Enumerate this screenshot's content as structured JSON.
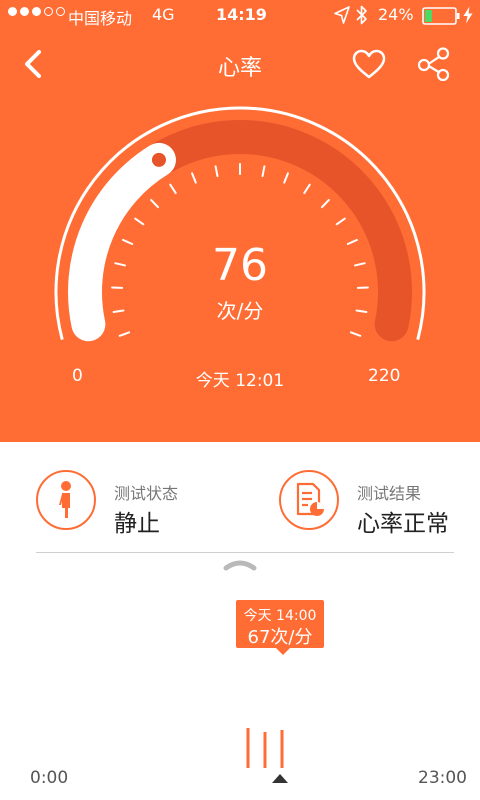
{
  "status_bar": {
    "signal_dots_filled": 3,
    "signal_dots_total": 5,
    "carrier": "中国移动",
    "network": "4G",
    "time": "14:19",
    "battery_percent_text": "24%",
    "battery_level": 0.24,
    "battery_color": "#4cd964"
  },
  "nav": {
    "title": "心率",
    "back_icon": "chevron-left-icon",
    "favorite_icon": "heart-outline-icon",
    "share_icon": "share-icon"
  },
  "gauge": {
    "value": "76",
    "value_number": 76,
    "unit": "次/分",
    "min_label": "0",
    "max_label": "220",
    "min": 0,
    "max": 220,
    "measured_at": "今天 12:01",
    "colors": {
      "background": "#ff6d35",
      "track": "#e8542a",
      "fill": "#ffffff",
      "knob_dot": "#e8542a"
    }
  },
  "info": {
    "state": {
      "label": "测试状态",
      "value": "静止",
      "icon": "standing-person-icon"
    },
    "result": {
      "label": "测试结果",
      "value": "心率正常",
      "icon": "report-icon"
    }
  },
  "timeline": {
    "tooltip_time": "今天 14:00",
    "tooltip_value": "67次/分",
    "start_label": "0:00",
    "end_label": "23:00",
    "accent_color": "#ff6d35"
  }
}
